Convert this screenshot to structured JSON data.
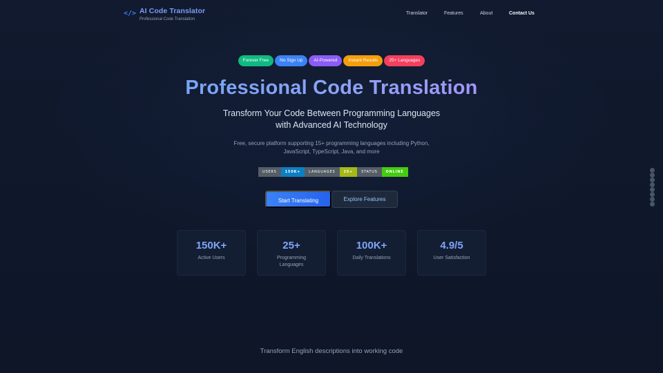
{
  "brand": {
    "icon": "code-brackets-icon",
    "icon_glyph": "</>",
    "title": "AI Code Translator",
    "subtitle": "Professional Code Translation"
  },
  "nav": [
    {
      "label": "Translator"
    },
    {
      "label": "Features"
    },
    {
      "label": "About"
    },
    {
      "label": "Contact Us"
    }
  ],
  "badges": [
    {
      "label": "Forever Free",
      "color": "#10b981"
    },
    {
      "label": "No Sign Up",
      "color": "#3b82f6"
    },
    {
      "label": "AI-Powered",
      "color": "#8b5cf6"
    },
    {
      "label": "Instant Results",
      "color": "#f59e0b"
    },
    {
      "label": "25+ Languages",
      "color": "#f43f5e"
    }
  ],
  "hero": {
    "title": "Professional Code Translation",
    "subtitle_line1": "Transform Your Code Between Programming Languages",
    "subtitle_line2": "with Advanced AI Technology",
    "desc_line1": "Free, secure platform supporting 15+ programming languages including Python,",
    "desc_line2": "JavaScript, TypeScript, Java, and more"
  },
  "shields": [
    {
      "key": "USERS",
      "value": "150K+",
      "color": "#0e7fc0"
    },
    {
      "key": "LANGUAGES",
      "value": "25+",
      "color": "#a4b816"
    },
    {
      "key": "STATUS",
      "value": "ONLINE",
      "color": "#44cc11"
    }
  ],
  "buttons": {
    "primary": "Start Translating",
    "secondary": "Explore Features"
  },
  "stats": [
    {
      "value": "150K+",
      "label": "Active Users"
    },
    {
      "value": "25+",
      "label": "Programming Languages"
    },
    {
      "value": "100K+",
      "label": "Daily Translations"
    },
    {
      "value": "4.9/5",
      "label": "User Satisfaction"
    }
  ],
  "footer_text": "Transform English descriptions into working code"
}
